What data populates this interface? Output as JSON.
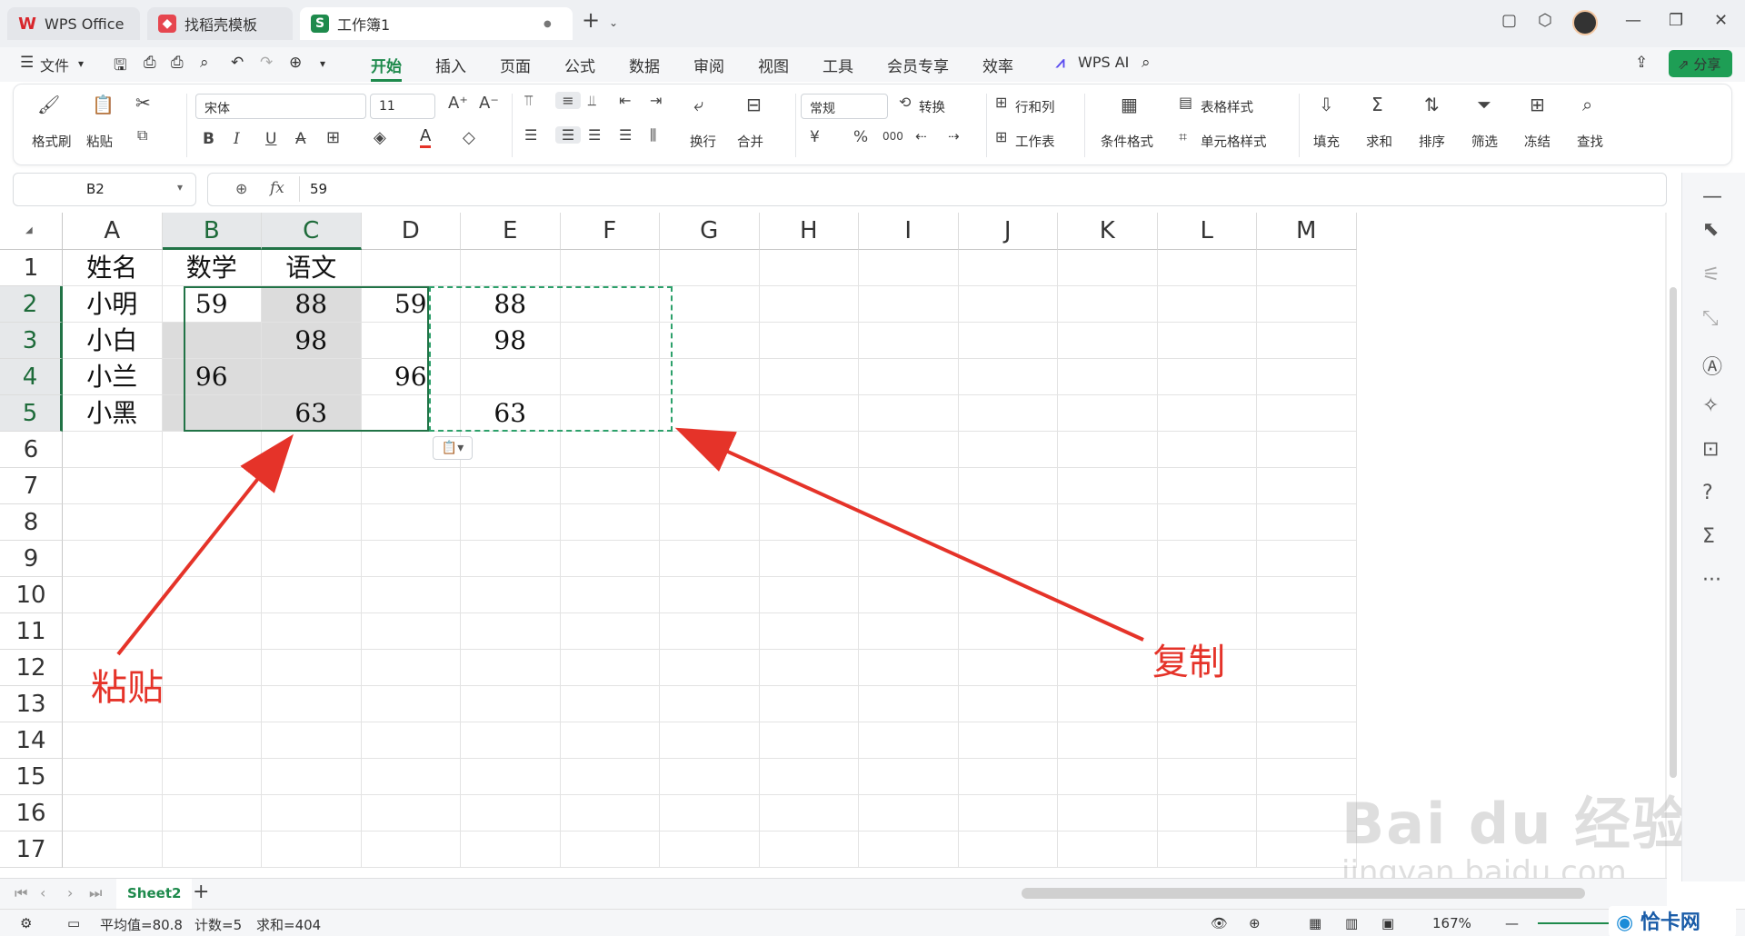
{
  "tabs": {
    "wps": "WPS Office",
    "template": "找稻壳模板",
    "workbook": "工作簿1",
    "dot": "●",
    "new": "+"
  },
  "menu": {
    "file": "文件",
    "start": "开始",
    "insert": "插入",
    "page": "页面",
    "formula": "公式",
    "data": "数据",
    "review": "审阅",
    "view": "视图",
    "tools": "工具",
    "member": "会员专享",
    "efficiency": "效率",
    "wpsai": "WPS AI",
    "share": "分享"
  },
  "ribbon": {
    "format_painter": "格式刷",
    "paste": "粘贴",
    "font": "宋体",
    "size": "11",
    "wrap": "换行",
    "merge": "合并",
    "number_format": "常规",
    "convert": "转换",
    "row_col": "行和列",
    "worksheet": "工作表",
    "cond_format": "条件格式",
    "table_style": "表格样式",
    "cell_style": "单元格样式",
    "fill": "填充",
    "sum": "求和",
    "sort": "排序",
    "filter": "筛选",
    "freeze": "冻结",
    "find": "查找",
    "bold": "B",
    "italic": "I",
    "underline": "U",
    "strike": "A",
    "yen": "¥",
    "pct": "%",
    "thousand": "000"
  },
  "formula_bar": {
    "cell_ref": "B2",
    "fx": "fx",
    "value": "59"
  },
  "columns": [
    "A",
    "B",
    "C",
    "D",
    "E",
    "F",
    "G",
    "H",
    "I",
    "J",
    "K",
    "L",
    "M"
  ],
  "rows": [
    "1",
    "2",
    "3",
    "4",
    "5",
    "6",
    "7",
    "8",
    "9",
    "10",
    "11",
    "12",
    "13",
    "14",
    "15",
    "16",
    "17"
  ],
  "cells": {
    "A1": "姓名",
    "B1": "数学",
    "C1": "语文",
    "A2": "小明",
    "B2": "59",
    "C2": "88",
    "D2": "59",
    "E2": "88",
    "A3": "小白",
    "C3": "98",
    "E3": "98",
    "A4": "小兰",
    "B4": "96",
    "D4": "96",
    "A5": "小黑",
    "C5": "63",
    "E5": "63"
  },
  "sheet": {
    "name": "Sheet2",
    "add": "+"
  },
  "status": {
    "avg": "平均值=80.8",
    "count": "计数=5",
    "sum": "求和=404",
    "zoom": "167%"
  },
  "annotations": {
    "paste": "粘贴",
    "copy": "复制"
  },
  "watermark": {
    "brand": "Bai du 经验",
    "url": "jingyan.baidu.com",
    "logo": "恰卡网"
  },
  "colors": {
    "accent": "#1e8a4c",
    "arrow": "#e53329",
    "selection": "#217346"
  }
}
